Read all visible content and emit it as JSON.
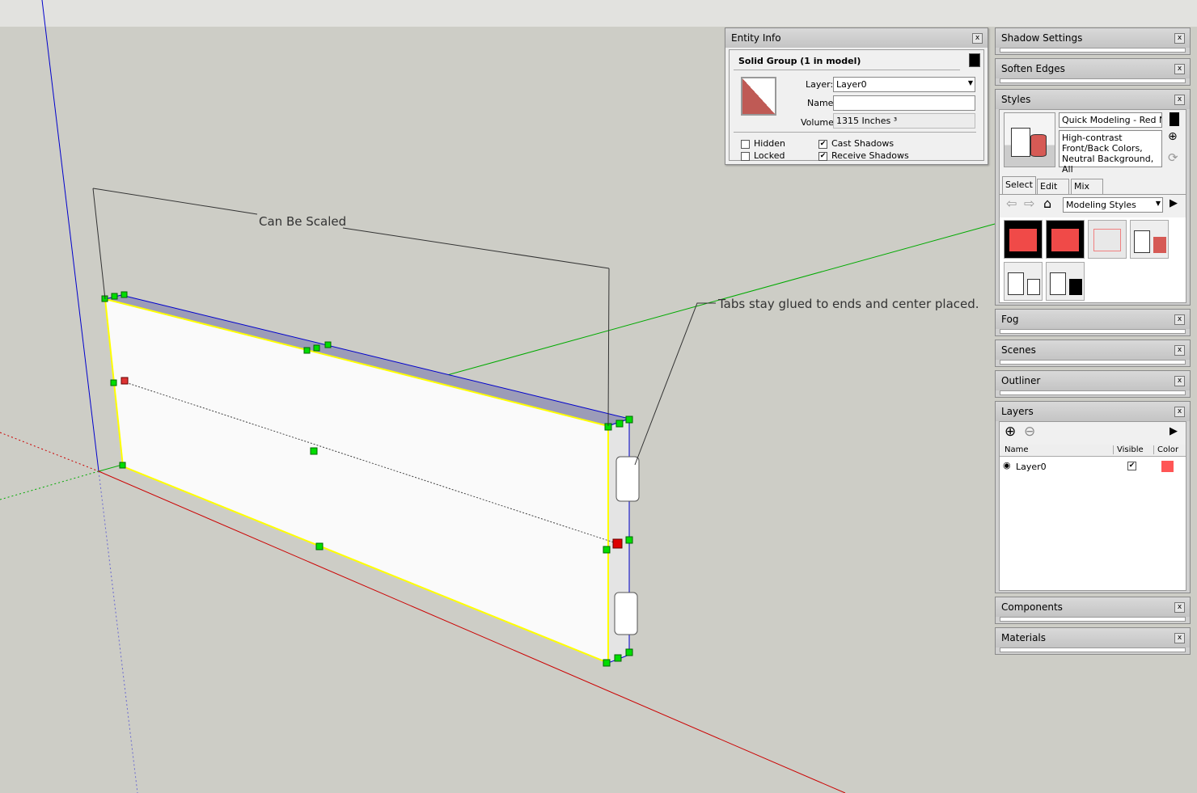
{
  "viewport": {
    "dimension_label": "Can Be Scaled",
    "leader_label": "Tabs stay glued to ends and center placed.",
    "colors": {
      "background": "#cdcdc6",
      "selection": "#ffff00",
      "grip": "#00dd00",
      "center_grip": "#dd0000",
      "x_axis": "#cc0000",
      "y_axis": "#00aa00",
      "z_axis": "#0000cc"
    }
  },
  "entity_info": {
    "title": "Entity Info",
    "heading": "Solid Group (1 in model)",
    "layer_label": "Layer:",
    "layer_value": "Layer0",
    "name_label": "Name:",
    "name_value": "",
    "volume_label": "Volume:",
    "volume_value": "1315 Inches ³",
    "hidden_label": "Hidden",
    "hidden": false,
    "locked_label": "Locked",
    "locked": false,
    "cast_label": "Cast Shadows",
    "cast": true,
    "receive_label": "Receive Shadows",
    "receive": true,
    "material_color": "#bf5a55"
  },
  "panels": {
    "shadow": "Shadow Settings",
    "soften": "Soften Edges",
    "styles": "Styles",
    "fog": "Fog",
    "scenes": "Scenes",
    "outliner": "Outliner",
    "layers": "Layers",
    "components": "Components",
    "materials": "Materials"
  },
  "styles": {
    "name": "Quick Modeling - Red Nor",
    "description": "High-contrast Front/Back Colors, Neutral Background, All",
    "tabs": [
      "Select",
      "Edit",
      "Mix"
    ],
    "collection": "Modeling Styles"
  },
  "layers": {
    "col_name": "Name",
    "col_visible": "Visible",
    "col_color": "Color",
    "rows": [
      {
        "name": "Layer0",
        "active": true,
        "visible": true,
        "color": "#ff5555"
      }
    ]
  }
}
